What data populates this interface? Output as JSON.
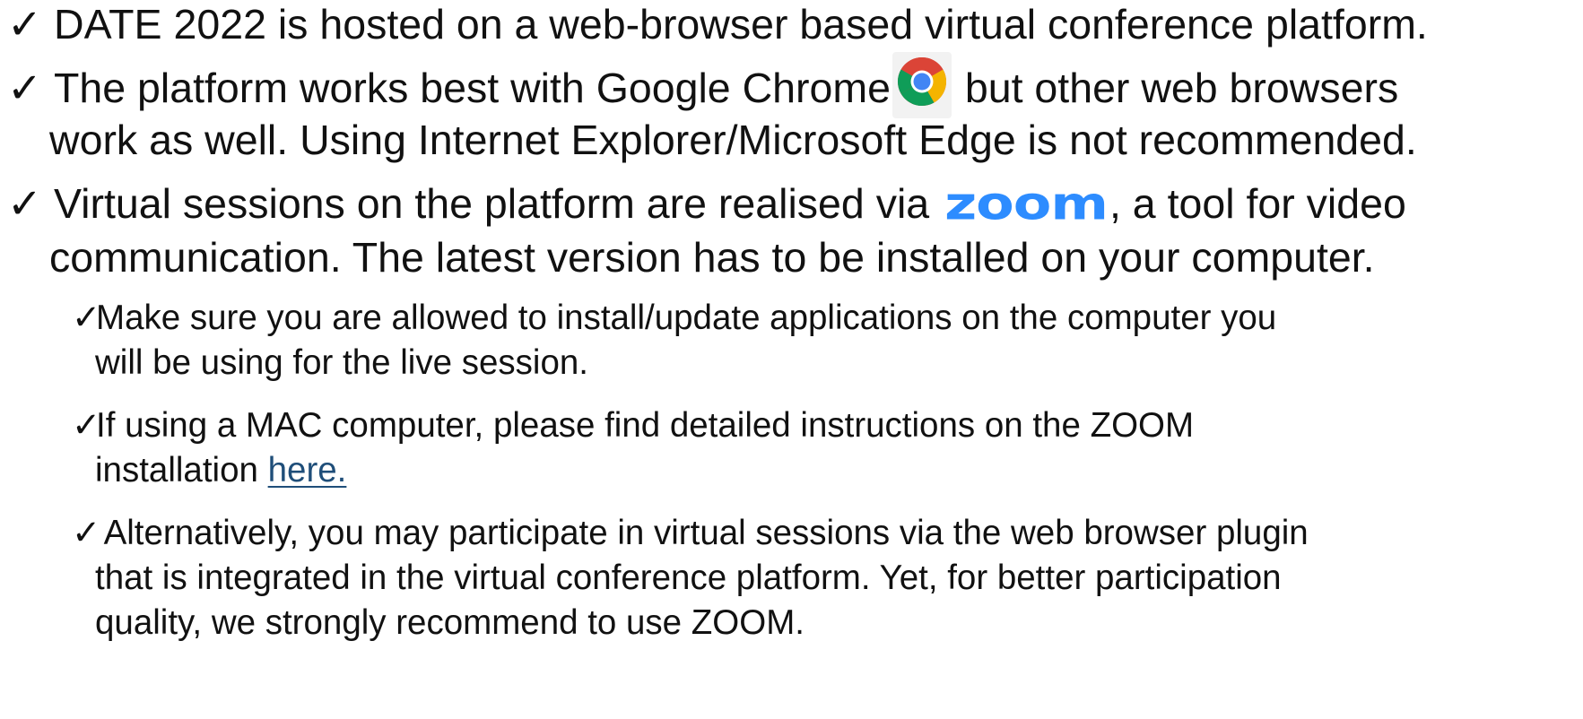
{
  "check_glyph": "✓",
  "bullets": [
    {
      "lines": [
        "DATE 2022 is hosted on a web-browser based virtual conference platform."
      ]
    },
    {
      "line1_before": "The platform works best with Google Chrome",
      "line1_icon": "chrome-icon",
      "line1_after": " but other web browsers",
      "line2": "work as well. Using Internet Explorer/Microsoft Edge is not recommended."
    },
    {
      "line1_before": "Virtual sessions on the platform are realised via ",
      "line1_logo_text": "zoom",
      "line1_after": ", a tool for video",
      "line2": "communication. The latest version has to be installed on your computer."
    }
  ],
  "sub_bullets": [
    {
      "line1": "Make sure you are allowed to install/update applications on the computer you",
      "line2": "will be using for the live session."
    },
    {
      "line1": "If using a MAC computer, please find detailed instructions on the ZOOM",
      "line2_before": "installation ",
      "line2_link": "here."
    },
    {
      "line1": " Alternatively, you may participate in virtual sessions via the web browser plugin",
      "line2": "that is integrated in the virtual conference platform. Yet, for better participation",
      "line3": "quality, we strongly recommend to use ZOOM."
    }
  ],
  "colors": {
    "text": "#111111",
    "link": "#1f4e79",
    "zoom_brand": "#2d8cff"
  }
}
